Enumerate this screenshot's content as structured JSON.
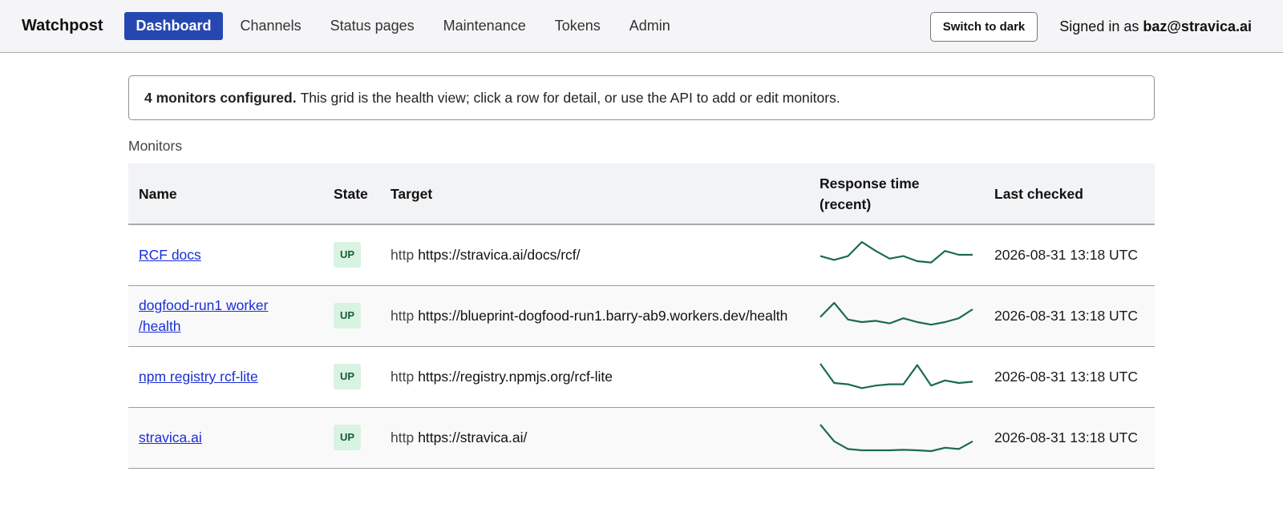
{
  "app": {
    "brand": "Watchpost",
    "nav": [
      "Dashboard",
      "Channels",
      "Status pages",
      "Maintenance",
      "Tokens",
      "Admin"
    ],
    "active_nav": "Dashboard",
    "theme_button": "Switch to dark",
    "signed_in_prefix": "Signed in as",
    "signed_in_user": "baz@stravica.ai"
  },
  "notice": {
    "bold": "4 monitors configured.",
    "text": "This grid is the health view; click a row for detail, or use the API to add or edit monitors."
  },
  "section_label": "Monitors",
  "table": {
    "headers": {
      "name": "Name",
      "state": "State",
      "target": "Target",
      "response": "Response time (recent)",
      "last": "Last checked"
    },
    "rows": [
      {
        "name": "RCF docs",
        "state": "UP",
        "protocol": "http",
        "url": "https://stravica.ai/docs/rcf/",
        "last_checked": "2026-08-31 13:18 UTC",
        "response_trend": [
          0.45,
          0.3,
          0.45,
          1.0,
          0.65,
          0.35,
          0.45,
          0.25,
          0.2,
          0.65,
          0.5,
          0.5
        ]
      },
      {
        "name": "dogfood-run1 worker /health",
        "state": "UP",
        "protocol": "http",
        "url": "https://blueprint-dogfood-run1.barry-ab9.workers.dev/health",
        "last_checked": "2026-08-31 13:18 UTC",
        "response_trend": [
          0.45,
          1.0,
          0.35,
          0.25,
          0.3,
          0.2,
          0.4,
          0.25,
          0.15,
          0.25,
          0.4,
          0.75
        ]
      },
      {
        "name": "npm registry rcf-lite",
        "state": "UP",
        "protocol": "http",
        "url": "https://registry.npmjs.org/rcf-lite",
        "last_checked": "2026-08-31 13:18 UTC",
        "response_trend": [
          1.0,
          0.25,
          0.2,
          0.05,
          0.15,
          0.2,
          0.2,
          0.95,
          0.15,
          0.35,
          0.25,
          0.3
        ]
      },
      {
        "name": "stravica.ai",
        "state": "UP",
        "protocol": "http",
        "url": "https://stravica.ai/",
        "last_checked": "2026-08-31 13:18 UTC",
        "response_trend": [
          1.0,
          0.35,
          0.05,
          0.0,
          0.0,
          0.0,
          0.02,
          0.0,
          -0.03,
          0.1,
          0.05,
          0.35
        ]
      }
    ]
  },
  "colors": {
    "accent": "#2747b0",
    "link": "#1a2ed6",
    "sparkline": "#1b6b4a",
    "up_badge_bg": "#d8f3e1",
    "up_badge_text": "#1a5c34"
  }
}
